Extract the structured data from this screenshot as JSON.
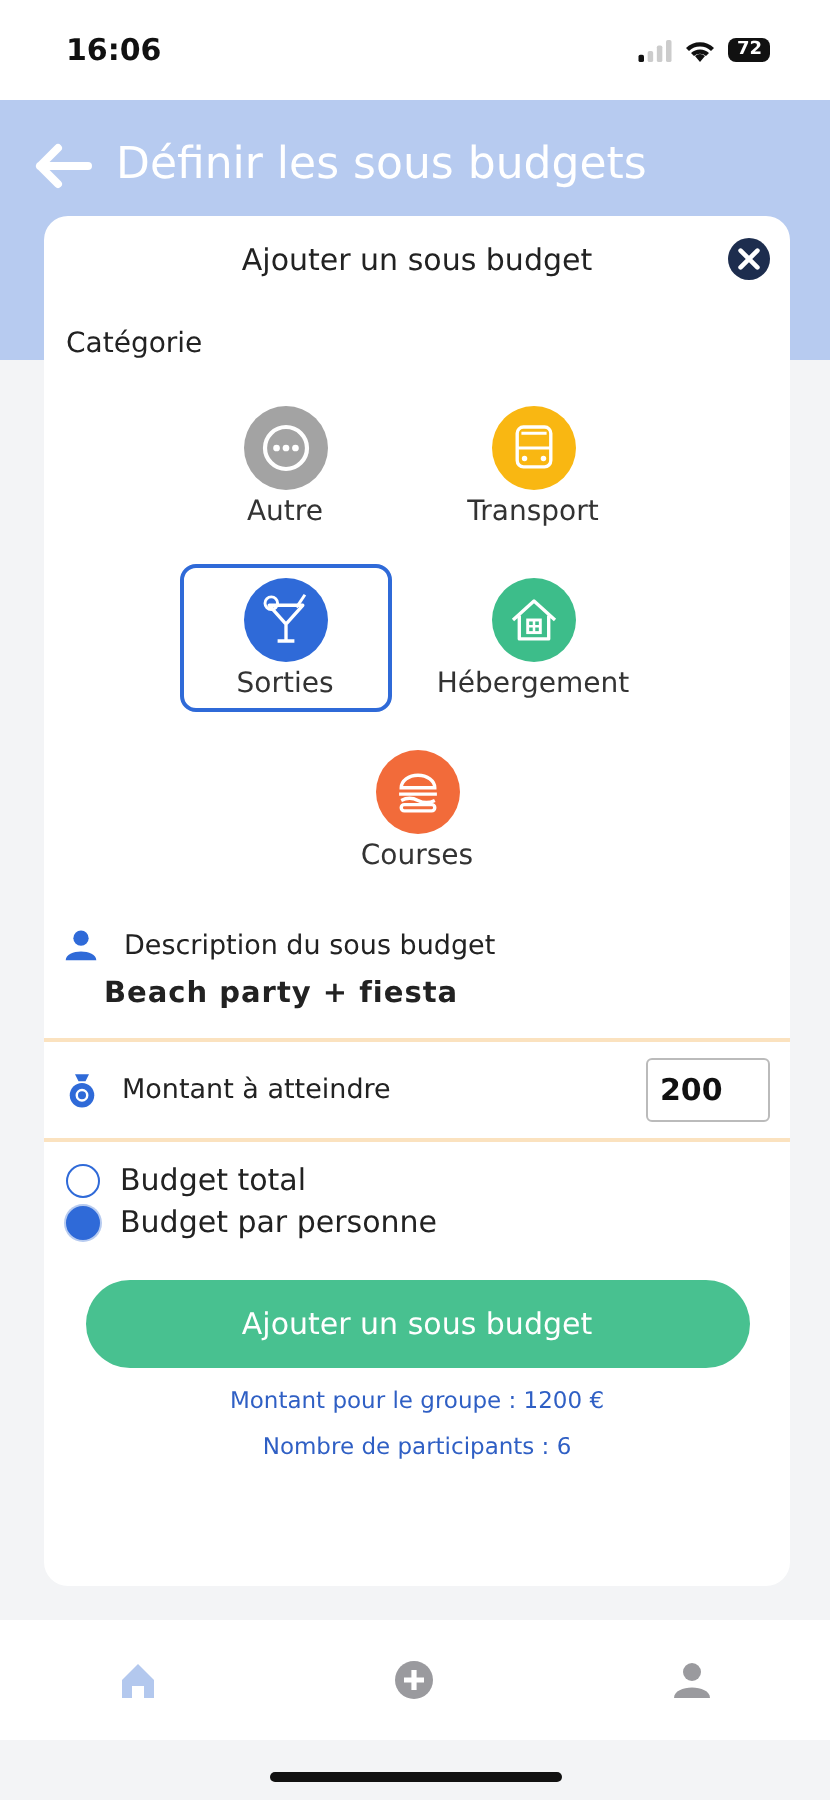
{
  "status_bar": {
    "time": "16:06",
    "battery": "72"
  },
  "header": {
    "title": "Définir les sous budgets"
  },
  "modal": {
    "title": "Ajouter un sous budget",
    "category_label": "Catégorie",
    "categories": [
      {
        "label": "Autre",
        "kind": "other",
        "color": "#a3a3a3",
        "selected": false
      },
      {
        "label": "Transport",
        "kind": "bus",
        "color": "#f9b712",
        "selected": false
      },
      {
        "label": "Sorties",
        "kind": "cocktail",
        "color": "#2f6ad8",
        "selected": true
      },
      {
        "label": "Hébergement",
        "kind": "house",
        "color": "#3dbd8a",
        "selected": false
      },
      {
        "label": "Courses",
        "kind": "burger",
        "color": "#f26b3a",
        "selected": false
      }
    ],
    "description": {
      "label": "Description du sous budget",
      "value": "Beach party + fiesta"
    },
    "amount": {
      "label": "Montant à atteindre",
      "value": "200"
    },
    "options": [
      {
        "label": "Budget total",
        "selected": false
      },
      {
        "label": "Budget par personne",
        "selected": true
      }
    ],
    "submit": "Ajouter un sous budget",
    "summary": [
      "Montant pour le groupe : 1200 €",
      "Nombre de participants : 6"
    ]
  },
  "nav": [
    {
      "kind": "home",
      "selected": true
    },
    {
      "kind": "add",
      "selected": false
    },
    {
      "kind": "profile",
      "selected": false
    }
  ]
}
